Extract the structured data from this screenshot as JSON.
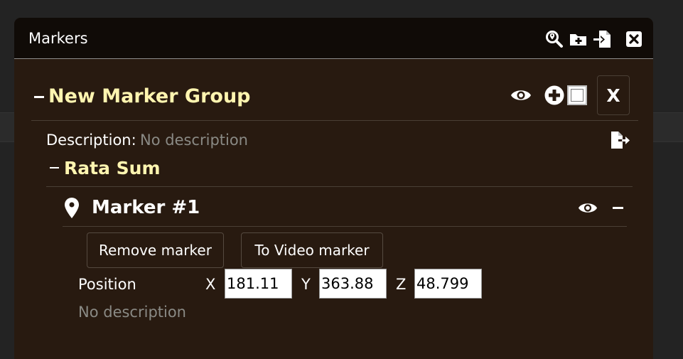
{
  "window": {
    "title": "Markers"
  },
  "toolbar": {
    "icons": [
      "search-location-icon",
      "folder-plus-icon",
      "file-import-icon",
      "close-square-icon"
    ]
  },
  "group": {
    "title": "New Marker Group",
    "close_label": "X",
    "description_label": "Description:",
    "description_value": "No description"
  },
  "subgroup": {
    "title": "Rata Sum"
  },
  "marker": {
    "title": "Marker #1",
    "remove_label": "Remove marker",
    "to_video_label": "To Video marker",
    "position_label": "Position",
    "x_label": "X",
    "y_label": "Y",
    "z_label": "Z",
    "x_value": "181.11",
    "y_value": "363.88",
    "z_value": "48.799",
    "description": "No description"
  },
  "colors": {
    "panel_bg": "#281a10",
    "titlebar_bg": "#100b07",
    "group_title": "#fff5b0",
    "muted_text": "#8a8a85"
  }
}
